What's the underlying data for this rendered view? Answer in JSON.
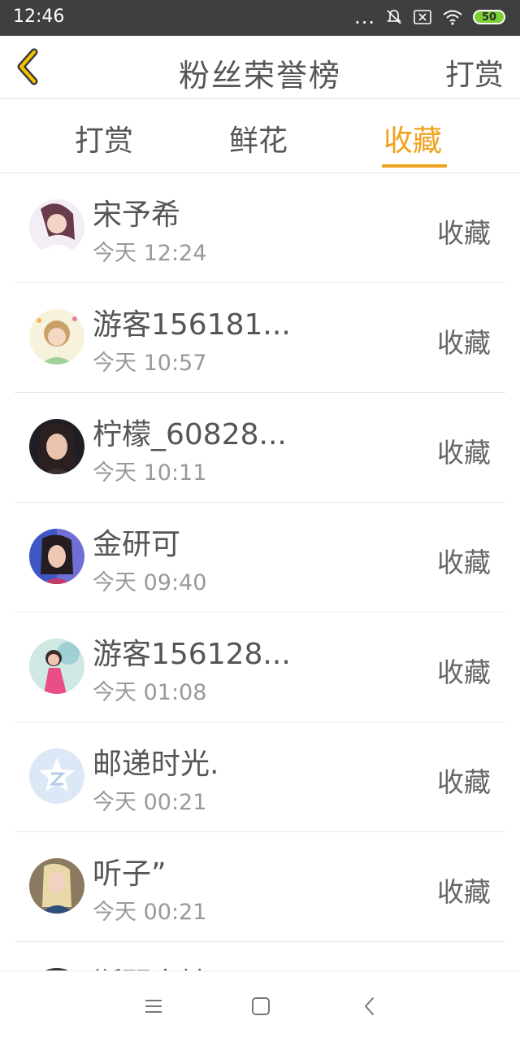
{
  "status_bar": {
    "time": "12:46",
    "dots": "...",
    "battery": "50"
  },
  "header": {
    "title": "粉丝荣誉榜",
    "right_action": "打赏"
  },
  "tabs": [
    {
      "label": "打赏"
    },
    {
      "label": "鲜花"
    },
    {
      "label": "收藏",
      "active": true
    }
  ],
  "rows": [
    {
      "name": "宋予希",
      "time": "今天 12:24",
      "action": "收藏",
      "avatar": "avatar-1"
    },
    {
      "name": "游客156181...",
      "time": "今天 10:57",
      "action": "收藏",
      "avatar": "avatar-2"
    },
    {
      "name": "柠檬_60828...",
      "time": "今天 10:11",
      "action": "收藏",
      "avatar": "avatar-3"
    },
    {
      "name": "金研可",
      "time": "今天 09:40",
      "action": "收藏",
      "avatar": "avatar-4"
    },
    {
      "name": "游客156128...",
      "time": "今天 01:08",
      "action": "收藏",
      "avatar": "avatar-5"
    },
    {
      "name": "邮递时光.",
      "time": "今天 00:21",
      "action": "收藏",
      "avatar": "avatar-6"
    },
    {
      "name": "听子”",
      "time": "今天 00:21",
      "action": "收藏",
      "avatar": "avatar-7"
    },
    {
      "name": "斯琴高娃",
      "time": "",
      "action": "",
      "avatar": "avatar-8"
    }
  ],
  "colors": {
    "accent": "#f0a11c",
    "status_bar": "#3f3f3f"
  },
  "icons": [
    "back-arrow-icon",
    "menu-icon",
    "home-square-icon",
    "back-chevron-icon"
  ]
}
